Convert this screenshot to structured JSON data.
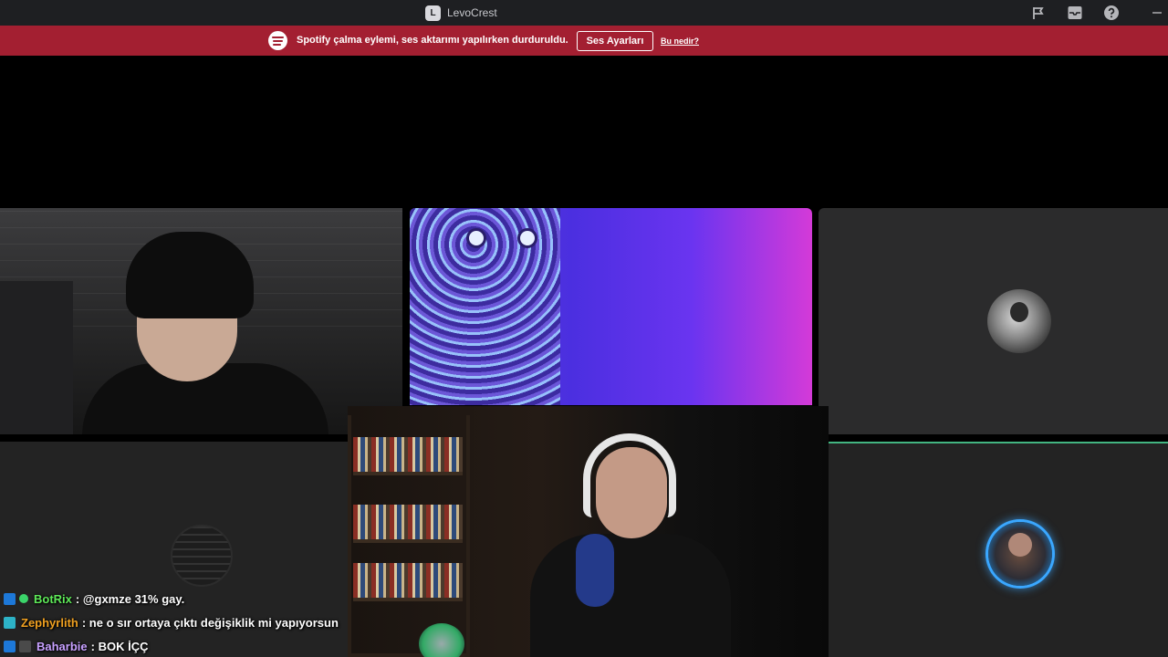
{
  "titlebar": {
    "app_name": "LevoCrest",
    "logo_glyph": "L",
    "icons": [
      "flag-icon",
      "inbox-icon",
      "help-icon",
      "minimize-icon"
    ]
  },
  "notice": {
    "text": "Spotify çalma eylemi, ses aktarımı yapılırken durduruldu.",
    "button_label": "Ses Ayarları",
    "link_label": "Bu nedir?",
    "background_color": "#a31f31"
  },
  "chat": {
    "messages": [
      {
        "user": "BotRix",
        "user_color": "#5ee858",
        "text": ": @gxmze 31% gay."
      },
      {
        "user": "Zephyrlith",
        "user_color": "#f0a020",
        "text": ": ne o sır ortaya çıktı değişiklik mi yapıyorsun"
      },
      {
        "user": "Baharbie",
        "user_color": "#c7a0ff",
        "text": ": BOK İÇÇ"
      }
    ]
  },
  "colors": {
    "speaking_indicator": "#43b581",
    "avatar_ring": "#3aa7ff"
  }
}
